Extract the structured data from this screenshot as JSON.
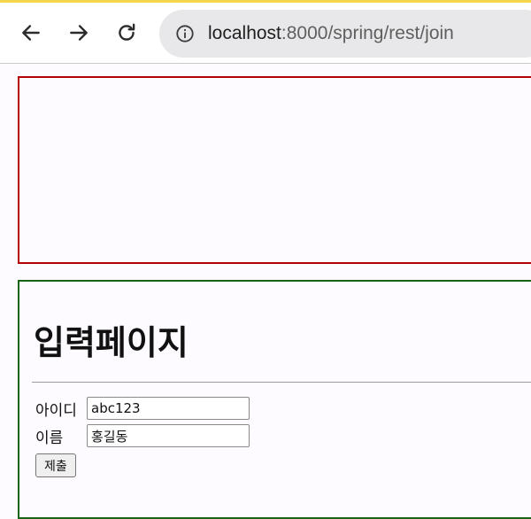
{
  "browser": {
    "url_host": "localhost",
    "url_rest": ":8000/spring/rest/join",
    "icons": {
      "back": "back-arrow-icon",
      "forward": "forward-arrow-icon",
      "reload": "reload-icon",
      "info": "info-icon"
    }
  },
  "page": {
    "title": "입력페이지",
    "form": {
      "id_label": "아이디",
      "id_value": "abc123",
      "name_label": "이름",
      "name_value": "홍길동",
      "submit_label": "제출"
    }
  },
  "colors": {
    "top_box_border": "#b30000",
    "form_box_border": "#176417"
  }
}
